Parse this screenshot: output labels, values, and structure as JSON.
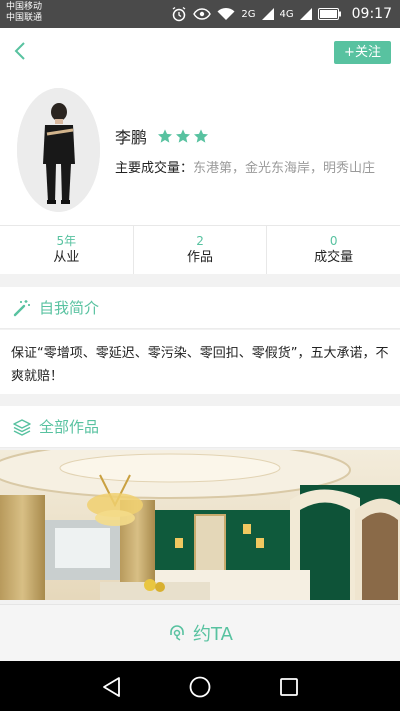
{
  "status_bar": {
    "carrier1": "中国移动",
    "carrier2": "中国联通",
    "network_1": "2G",
    "network_2": "4G",
    "time": "09:17",
    "icons": [
      "alarm-icon",
      "eye-icon",
      "wifi-icon",
      "signal-icon",
      "battery-icon"
    ]
  },
  "header": {
    "back_icon": "chevron-left-icon",
    "follow_label": "+关注"
  },
  "profile": {
    "name": "李鹏",
    "rating": 3,
    "deals_label": "主要成交量：",
    "deals_value": "东港第，金光东海岸，明秀山庄"
  },
  "stats": [
    {
      "value": "5年",
      "label": "从业"
    },
    {
      "value": "2",
      "label": "作品"
    },
    {
      "value": "0",
      "label": "成交量"
    }
  ],
  "intro": {
    "title": "自我简介",
    "icon": "magic-wand-icon",
    "text": "保证“零增项、零延迟、零污染、零回扣、零假货”，五大承诺，不爽就赔！"
  },
  "works": {
    "title": "全部作品",
    "icon": "layers-icon"
  },
  "book": {
    "label": "约TA",
    "icon": "headset-icon"
  },
  "colors": {
    "accent": "#58c2a0",
    "status_bar": "#4a4a4a",
    "nav_bar": "#000000"
  }
}
